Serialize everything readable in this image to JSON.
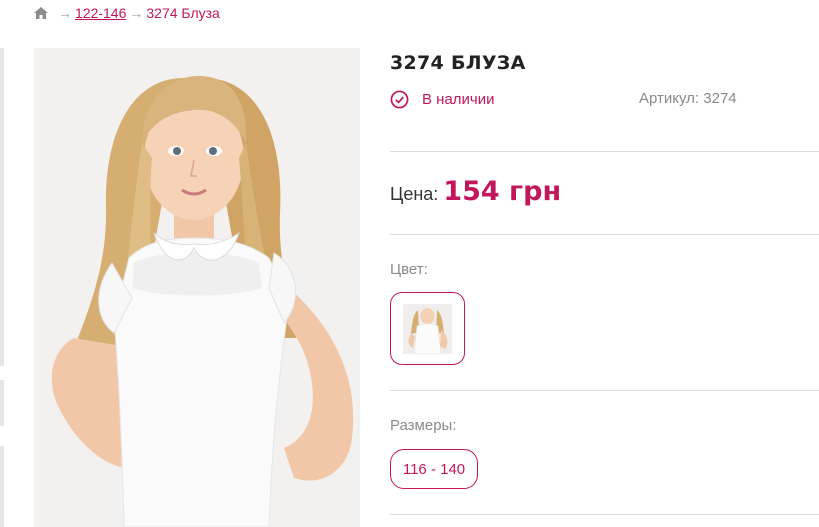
{
  "breadcrumb": {
    "home_icon": "home-icon",
    "separator": "→",
    "category": "122-146",
    "current": "3274 Блуза"
  },
  "product": {
    "title": "3274 БЛУЗА",
    "stock_icon": "check-circle-icon",
    "stock_text": "В наличии",
    "article_text": "Артикул: 3274",
    "price_label": "Цена:",
    "price_value": "154 грн",
    "color_label": "Цвет:",
    "size_label": "Размеры:",
    "sizes": [
      "116 - 140"
    ]
  },
  "colors": {
    "accent": "#c2185b",
    "muted_text": "#8a8a8a",
    "divider": "#dcdcdc"
  }
}
